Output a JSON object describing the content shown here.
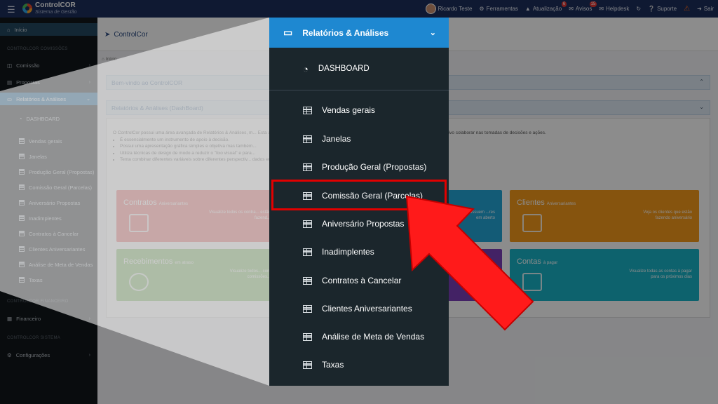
{
  "topbar": {
    "brand_name": "ControlCOR",
    "brand_sub": "Sistema de Gestão",
    "user": "Ricardo Teste",
    "items": [
      {
        "label": "Ferramentas"
      },
      {
        "label": "Atualização",
        "badge": "6"
      },
      {
        "label": "Avisos",
        "badge": "15"
      },
      {
        "label": "Helpdesk"
      },
      {
        "label": "Suporte"
      },
      {
        "label": "Sair"
      }
    ]
  },
  "sidebar": {
    "home": "Início",
    "sec_comissoes": "CONTROLCOR COMISSÕES",
    "comissao": "Comissão",
    "propostas": "Propostas",
    "relatorios": "Relatórios & Análises",
    "dashboard": "DASHBOARD",
    "subitems": [
      "Vendas gerais",
      "Janelas",
      "Produção Geral (Propostas)",
      "Comissão Geral (Parcelas)",
      "Aniversário Propostas",
      "Inadimplentes",
      "Contratos à Cancelar",
      "Clientes Aniversariantes",
      "Análise de Meta de Vendas",
      "Taxas"
    ],
    "sec_financeiro": "CONTROLCOR FINANCEIRO",
    "financeiro": "Financeiro",
    "sec_sistema": "CONTROLCOR SISTEMA",
    "configuracoes": "Configurações"
  },
  "main": {
    "title": "ControlCor",
    "breadcrumb": "Início",
    "welcome_panel": "Bem-vindo ao ControlCOR",
    "dash_panel": "Relatórios & Análises (DashBoard)",
    "intro": "O ControlCor possui uma área avançada de Relatórios & Análises, m... Esta área é essencialmente um instrumento de gestão para a monitorização que tem por objetivo colaborar nas tomadas de decisões e ações.",
    "bullets": [
      "É essencialmente um instrumento de apoio à decisão.",
      "Possui uma apresentação gráfica simples e objetiva mas também...",
      "Utiliza técnicas de design de modo a reduzir o \"lixo visual\" e para...",
      "Tenta combinar diferentes variáveis sobre diferentes perspectiv... dados em separado."
    ],
    "tiles": [
      {
        "title": "Contratos",
        "tag": "Aniversariantes",
        "desc": "Visualize todos os contra... estão fazend...",
        "color": "#f06e6e"
      },
      {
        "title": "Recebimentos",
        "tag": "em atraso",
        "desc": "Visualize todos... com comissões...",
        "color": "#86c26a"
      },
      {
        "title": "",
        "tag": "",
        "desc": "...ue possuem ...res em aberto",
        "color": "#23a6d8"
      },
      {
        "title": "",
        "tag": "",
        "desc": "",
        "color": "#7a3fb8"
      },
      {
        "title": "Clientes",
        "tag": "Aniversariantes",
        "desc": "Veja os clientes que estão fazendo aniversário",
        "color": "#f59a1b"
      },
      {
        "title": "Contas",
        "tag": "à pagar",
        "desc": "Visualize todas as contas à pagar para os próximos dias",
        "color": "#19b3c7"
      }
    ]
  },
  "zoom": {
    "header": "Relatórios & Análises",
    "dashboard": "DASHBOARD",
    "items": [
      "Vendas gerais",
      "Janelas",
      "Produção Geral (Propostas)",
      "Comissão Geral (Parcelas)",
      "Aniversário Propostas",
      "Inadimplentes",
      "Contratos à Cancelar",
      "Clientes Aniversariantes",
      "Análise de Meta de Vendas",
      "Taxas"
    ],
    "highlighted_index": 3
  },
  "colors": {
    "topbar": "#1d2f5c",
    "sidebar": "#11161b",
    "active": "#1e6fa8",
    "zoom_header": "#1e88d1",
    "highlight": "#e10000"
  }
}
